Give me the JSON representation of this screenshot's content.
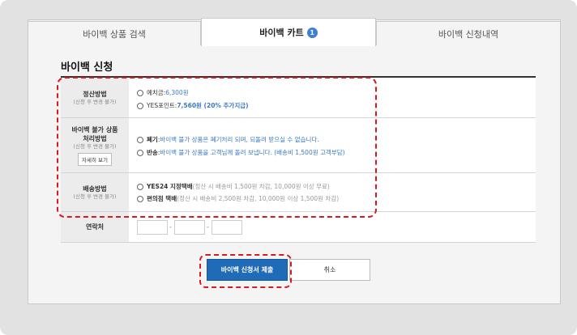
{
  "tabs": [
    {
      "label": "바이백 상품 검색"
    },
    {
      "label": "바이백 카트",
      "badge": "1"
    },
    {
      "label": "바이백 신청내역"
    }
  ],
  "form": {
    "title": "바이백 신청",
    "settlement": {
      "label": "정산방법",
      "sub": "(신청 후 변경 불가)",
      "options": [
        {
          "name": "예치금",
          "sep": " : ",
          "value": "6,300원"
        },
        {
          "name": "YES포인트",
          "sep": " : ",
          "value": "7,560원 (20% 추가지급)"
        }
      ]
    },
    "unsellable": {
      "label_line1": "바이백 불가 상품",
      "label_line2": "처리방법",
      "sub": "(신청 후 변경 불가)",
      "detail_button": "자세히 보기",
      "options": [
        {
          "name": "폐기",
          "sep": " : ",
          "desc": "바이백 불가 상품은 폐기처리 되며, 되돌려 받으실 수 없습니다."
        },
        {
          "name": "반송",
          "sep": " : ",
          "desc": "바이백 불가 상품을 고객님께 돌려 보냅니다. (배송비 1,500원 고객부담)"
        }
      ]
    },
    "shipping": {
      "label": "배송방법",
      "sub": "(신청 후 변경 불가)",
      "options": [
        {
          "name": "YES24 지정택배",
          "desc": " (정산 시 배송비 1,500원 차감, 10,000원 이상 무료)"
        },
        {
          "name": "편의점 택배",
          "desc": " (정산 시 배송비 2,500원 차감, 10,000원 이상 1,500원 차감)"
        }
      ]
    },
    "contact": {
      "label": "연락처",
      "separator": "-",
      "fields": [
        "",
        "",
        ""
      ]
    }
  },
  "buttons": {
    "submit": "바이백 신청서 제출",
    "cancel": "취소"
  },
  "colors": {
    "accent_blue": "#1f6bb8",
    "highlight_red": "#d71920"
  }
}
